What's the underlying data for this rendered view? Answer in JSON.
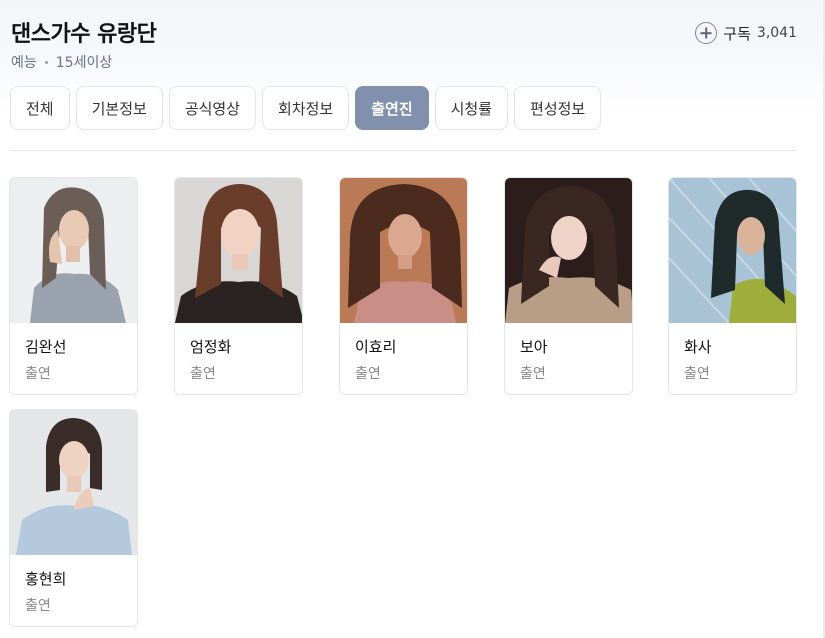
{
  "header": {
    "title": "댄스가수 유랑단",
    "genre": "예능",
    "rating": "15세이상",
    "subscribe_label": "구독",
    "subscribe_count": "3,041"
  },
  "tabs": [
    {
      "label": "전체",
      "active": false
    },
    {
      "label": "기본정보",
      "active": false
    },
    {
      "label": "공식영상",
      "active": false
    },
    {
      "label": "회차정보",
      "active": false
    },
    {
      "label": "출연진",
      "active": true
    },
    {
      "label": "시청률",
      "active": false
    },
    {
      "label": "편성정보",
      "active": false
    }
  ],
  "cast": [
    {
      "name": "김완선",
      "role": "출연"
    },
    {
      "name": "엄정화",
      "role": "출연"
    },
    {
      "name": "이효리",
      "role": "출연"
    },
    {
      "name": "보아",
      "role": "출연"
    },
    {
      "name": "화사",
      "role": "출연"
    },
    {
      "name": "홍현희",
      "role": "출연"
    }
  ],
  "colors": {
    "active_tab": "#8190ac",
    "border": "#e3e6eb",
    "muted_text": "#888888"
  },
  "icons": {
    "subscribe": "plus-circle-icon"
  }
}
